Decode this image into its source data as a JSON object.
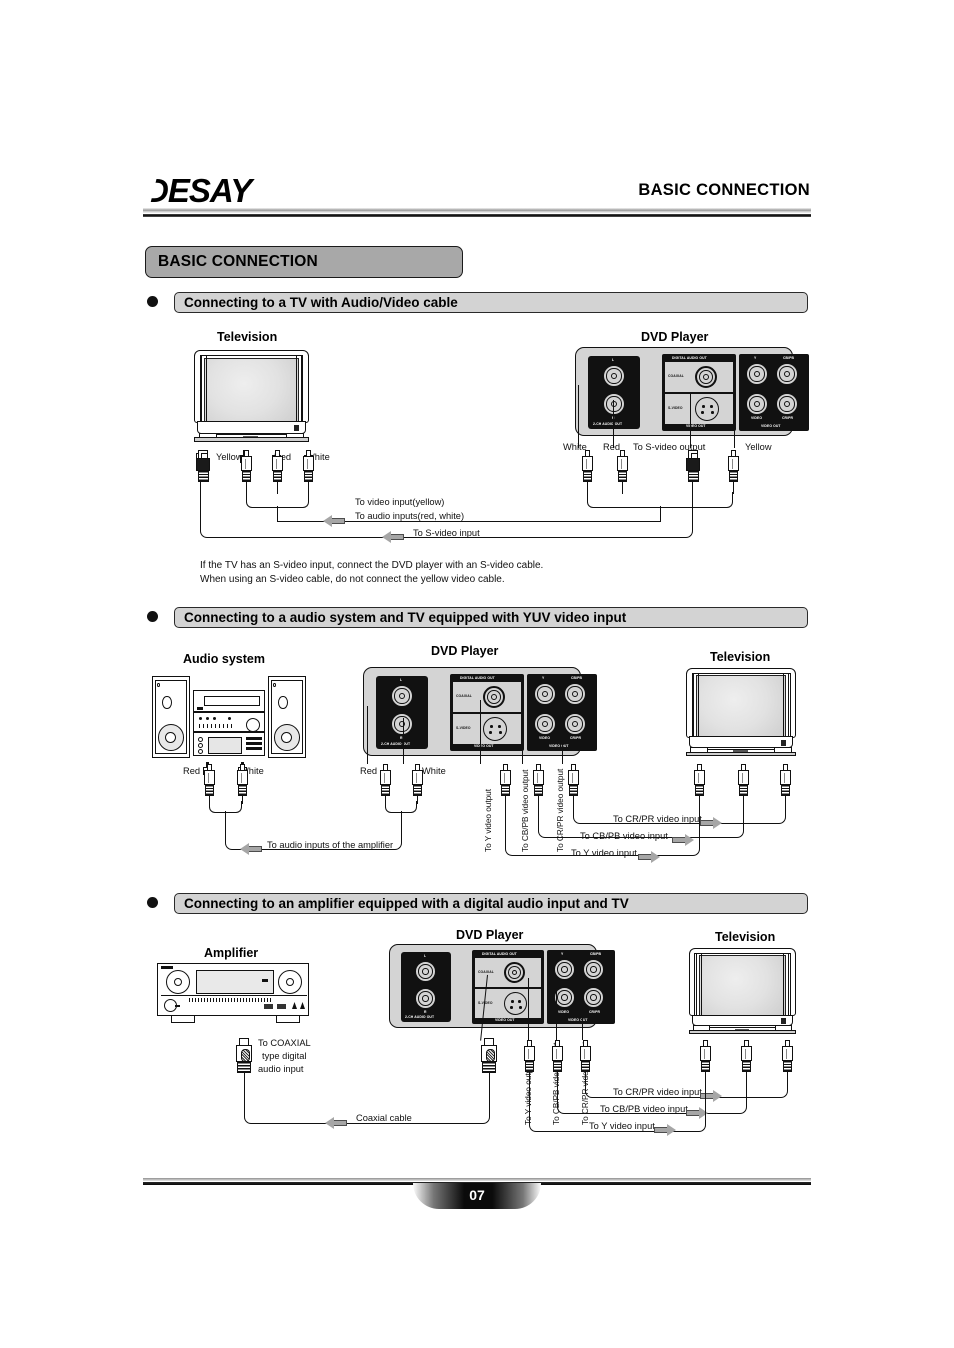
{
  "brand": {
    "logo": "DESAY"
  },
  "header": {
    "title": "BASIC CONNECTION"
  },
  "page_title": "BASIC CONNECTION",
  "footer": {
    "page_number": "07"
  },
  "sections": [
    {
      "id": "s1",
      "heading": "Connecting to a TV with Audio/Video cable",
      "devices": {
        "left": "Television",
        "right": "DVD Player"
      },
      "panel_labels": {
        "audio_group": "2-CH AUDIO OUT",
        "audio_l": "L",
        "audio_r": "R",
        "digital_group": "DIGITAL AUDIO OUT",
        "coaxial": "COAXIAL",
        "svideo": "S-VIDEO",
        "video_out_left": "VIDEO OUT",
        "video_out_right": "VIDEO OUT",
        "y": "Y",
        "cb_pb": "CB/PB",
        "cr_pr": "CR/PR",
        "video": "VIDEO"
      },
      "tv_plug_labels": [
        "Yellow",
        "Red",
        "White"
      ],
      "dvd_plug_labels": [
        "White",
        "Red",
        "To S-video output",
        "Yellow"
      ],
      "connections": [
        "To video input(yellow)",
        "To audio inputs(red, white)",
        "To S-video input"
      ],
      "notes": [
        "If the TV has an S-video input, connect the DVD player with an S-video cable.",
        "When using an S-video cable, do not connect the yellow video cable."
      ]
    },
    {
      "id": "s2",
      "heading": "Connecting to a audio system and TV equipped with YUV video input",
      "devices": {
        "left": "Audio system",
        "center": "DVD Player",
        "right": "Television"
      },
      "panel_labels": {
        "audio_group": "2-CH AUDIO OUT",
        "audio_l": "L",
        "audio_r": "R",
        "digital_group": "DIGITAL AUDIO OUT",
        "coaxial": "COAXIAL",
        "svideo": "S-VIDEO",
        "video_out_left": "VIDEO OUT",
        "video_out_right": "VIDEO OUT",
        "y": "Y",
        "cb_pb": "CB/PB",
        "cr_pr": "CR/PR",
        "video": "VIDEO"
      },
      "audio_plug_labels": [
        "Red",
        "White"
      ],
      "dvd_audio_plug_labels": [
        "Red",
        "White"
      ],
      "vertical_outputs": [
        "To Y video output",
        "To CB/PB video output",
        "To CR/PR video output"
      ],
      "connections": [
        "To audio inputs of the amplifier",
        "To CR/PR video input",
        "To CB/PB video input",
        "To Y video input"
      ]
    },
    {
      "id": "s3",
      "heading": "Connecting to an amplifier equipped with a digital audio input and TV",
      "devices": {
        "left": "Amplifier",
        "center": "DVD Player",
        "right": "Television"
      },
      "panel_labels": {
        "audio_group": "2-CH AUDIO OUT",
        "audio_l": "L",
        "audio_r": "R",
        "digital_group": "DIGITAL AUDIO OUT",
        "coaxial": "COAXIAL",
        "svideo": "S-VIDEO",
        "video_out_left": "VIDEO OUT",
        "video_out_right": "VIDEO OUT",
        "y": "Y",
        "cb_pb": "CB/PB",
        "cr_pr": "CR/PR",
        "video": "VIDEO"
      },
      "coax_label_lines": [
        "To COAXIAL",
        "type digital",
        "audio input"
      ],
      "vertical_outputs": [
        "To Y video output",
        "To CB/PB video output",
        "To CR/PR video output"
      ],
      "connections": [
        "Coaxial cable",
        "To CR/PR video input",
        "To CB/PB video input",
        "To Y video input"
      ]
    }
  ]
}
